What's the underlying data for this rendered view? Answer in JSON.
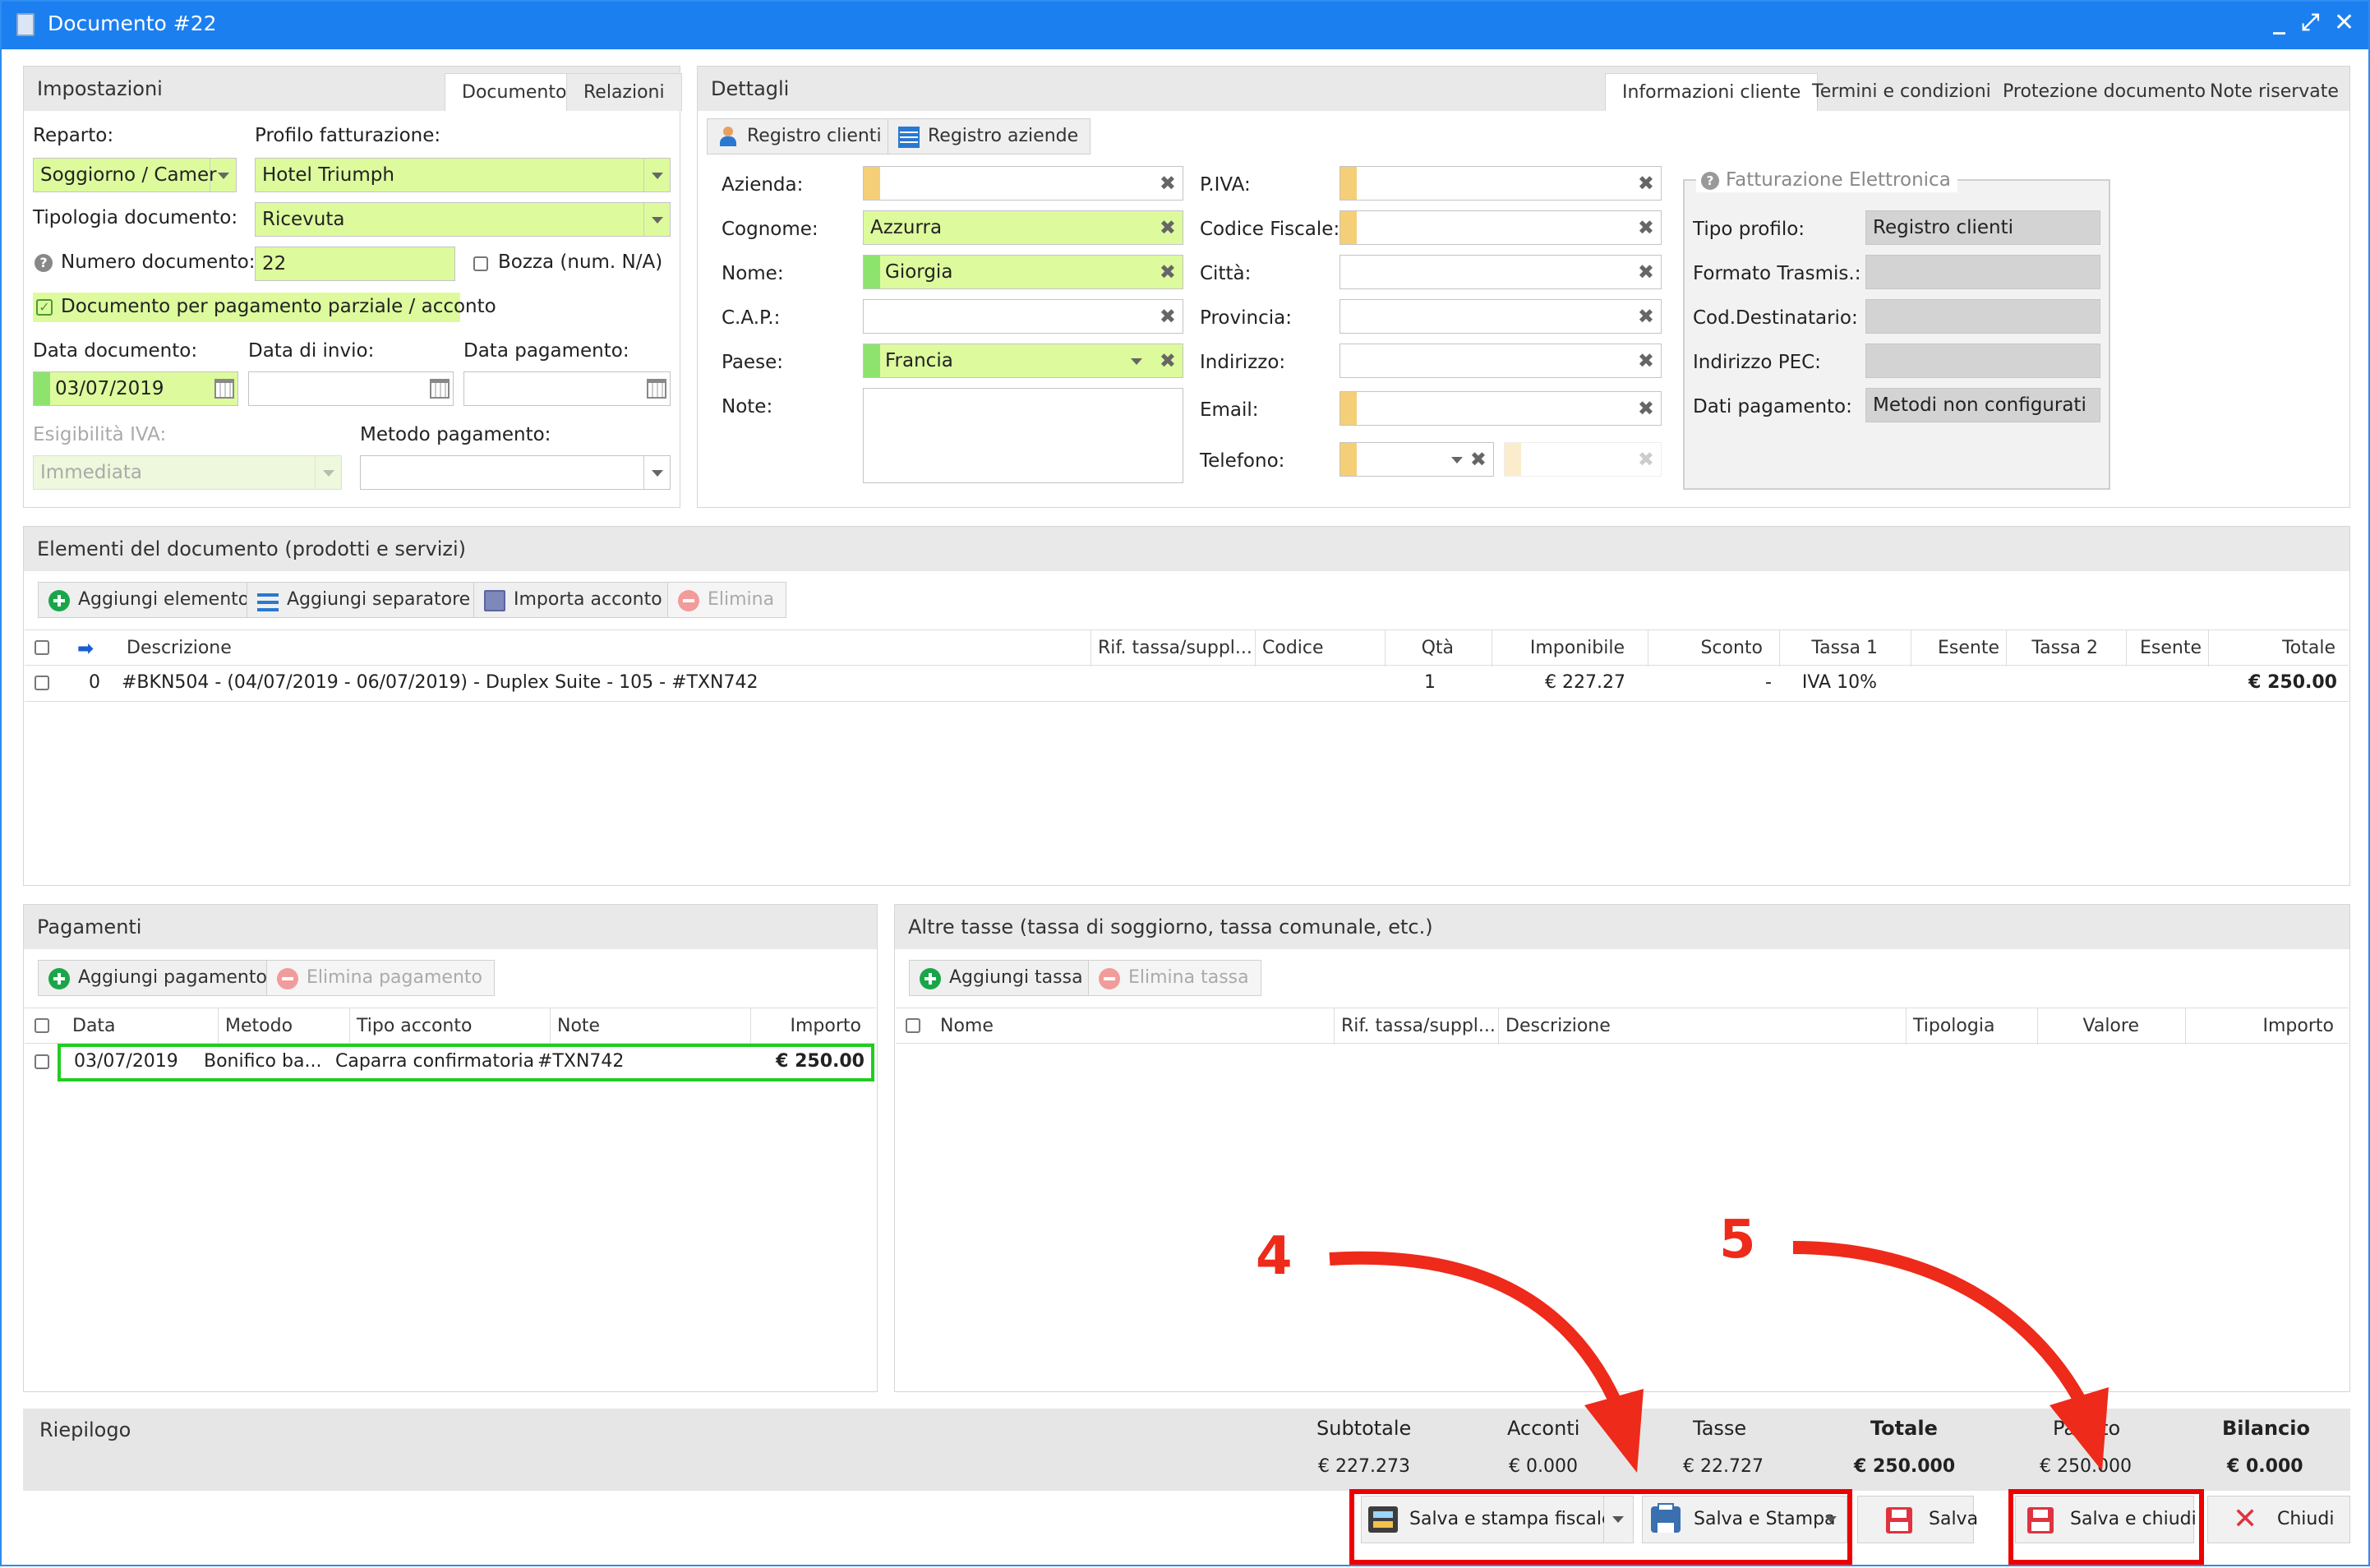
{
  "window": {
    "title": "Documento #22"
  },
  "impostazioni": {
    "title": "Impostazioni",
    "tabs": [
      "Documento",
      "Relazioni"
    ],
    "reparto_label": "Reparto:",
    "reparto_value": "Soggiorno / Camer",
    "profilo_label": "Profilo fatturazione:",
    "profilo_value": "Hotel Triumph",
    "tipologia_label": "Tipologia documento:",
    "tipologia_value": "Ricevuta",
    "numero_label": "Numero documento:",
    "numero_value": "22",
    "bozza_label": "Bozza (num. N/A)",
    "parziale_label": "Documento per pagamento parziale / acconto",
    "data_doc_label": "Data documento:",
    "data_doc_value": "03/07/2019",
    "data_invio_label": "Data di invio:",
    "data_pag_label": "Data pagamento:",
    "esigibilita_label": "Esigibilità IVA:",
    "esigibilita_value": "Immediata",
    "metodo_label": "Metodo pagamento:"
  },
  "dettagli": {
    "title": "Dettagli",
    "tabs": [
      "Informazioni cliente",
      "Termini e condizioni",
      "Protezione documento",
      "Note riservate"
    ],
    "registro_clienti": "Registro clienti",
    "registro_aziende": "Registro aziende",
    "azienda_label": "Azienda:",
    "cognome_label": "Cognome:",
    "cognome_value": "Azzurra",
    "nome_label": "Nome:",
    "nome_value": "Giorgia",
    "cap_label": "C.A.P.:",
    "paese_label": "Paese:",
    "paese_value": "Francia",
    "note_label": "Note:",
    "piva_label": "P.IVA:",
    "cf_label": "Codice Fiscale:",
    "citta_label": "Città:",
    "provincia_label": "Provincia:",
    "indirizzo_label": "Indirizzo:",
    "email_label": "Email:",
    "telefono_label": "Telefono:"
  },
  "fe": {
    "title": "Fatturazione Elettronica",
    "tipo_label": "Tipo profilo:",
    "tipo_value": "Registro clienti",
    "formato_label": "Formato Trasmis.:",
    "coddest_label": "Cod.Destinatario:",
    "pec_label": "Indirizzo PEC:",
    "datipag_label": "Dati pagamento:",
    "datipag_value": "Metodi non configurati"
  },
  "elementi": {
    "title": "Elementi del documento (prodotti e servizi)",
    "buttons": [
      "Aggiungi elemento",
      "Aggiungi separatore",
      "Importa acconto",
      "Elimina"
    ],
    "columns": [
      "Descrizione",
      "Rif. tassa/suppl...",
      "Codice",
      "Qtà",
      "Imponibile",
      "Sconto",
      "Tassa 1",
      "Esente",
      "Tassa 2",
      "Esente",
      "Totale"
    ],
    "row": {
      "index": "0",
      "descrizione": "#BKN504 - (04/07/2019 - 06/07/2019) - Duplex Suite - 105 - #TXN742",
      "qta": "1",
      "imponibile": "€ 227.27",
      "sconto": "-",
      "tassa1": "IVA 10%",
      "totale": "€ 250.00"
    }
  },
  "pagamenti": {
    "title": "Pagamenti",
    "add": "Aggiungi pagamento",
    "delete": "Elimina pagamento",
    "columns": [
      "Data",
      "Metodo",
      "Tipo acconto",
      "Note",
      "Importo"
    ],
    "row": {
      "data": "03/07/2019",
      "metodo": "Bonifico ba...",
      "tipo": "Caparra confirmatoria",
      "note": "#TXN742",
      "importo": "€ 250.00"
    }
  },
  "tasse": {
    "title": "Altre tasse (tassa di soggiorno, tassa comunale, etc.)",
    "add": "Aggiungi tassa",
    "delete": "Elimina tassa",
    "columns": [
      "Nome",
      "Rif. tassa/suppl...",
      "Descrizione",
      "Tipologia",
      "Valore",
      "Importo"
    ]
  },
  "riepilogo": {
    "title": "Riepilogo",
    "labels": [
      "Subtotale",
      "Acconti",
      "Tasse",
      "Totale",
      "Pagato",
      "Bilancio"
    ],
    "values": [
      "€ 227.273",
      "€ 0.000",
      "€ 22.727",
      "€ 250.000",
      "€ 250.000",
      "€ 0.000"
    ]
  },
  "footer": {
    "fiscale": "Salva e stampa fiscale",
    "stampa": "Salva e Stampa",
    "salva": "Salva",
    "salva_chiudi": "Salva e chiudi",
    "chiudi": "Chiudi"
  },
  "annotations": {
    "step4": "4",
    "step5": "5"
  },
  "colors": {
    "titlebar": "#1c7ff0",
    "field_green": "#ddfb9d",
    "annotation_red": "#ee2a1a",
    "highlight_green": "#22cc22"
  }
}
